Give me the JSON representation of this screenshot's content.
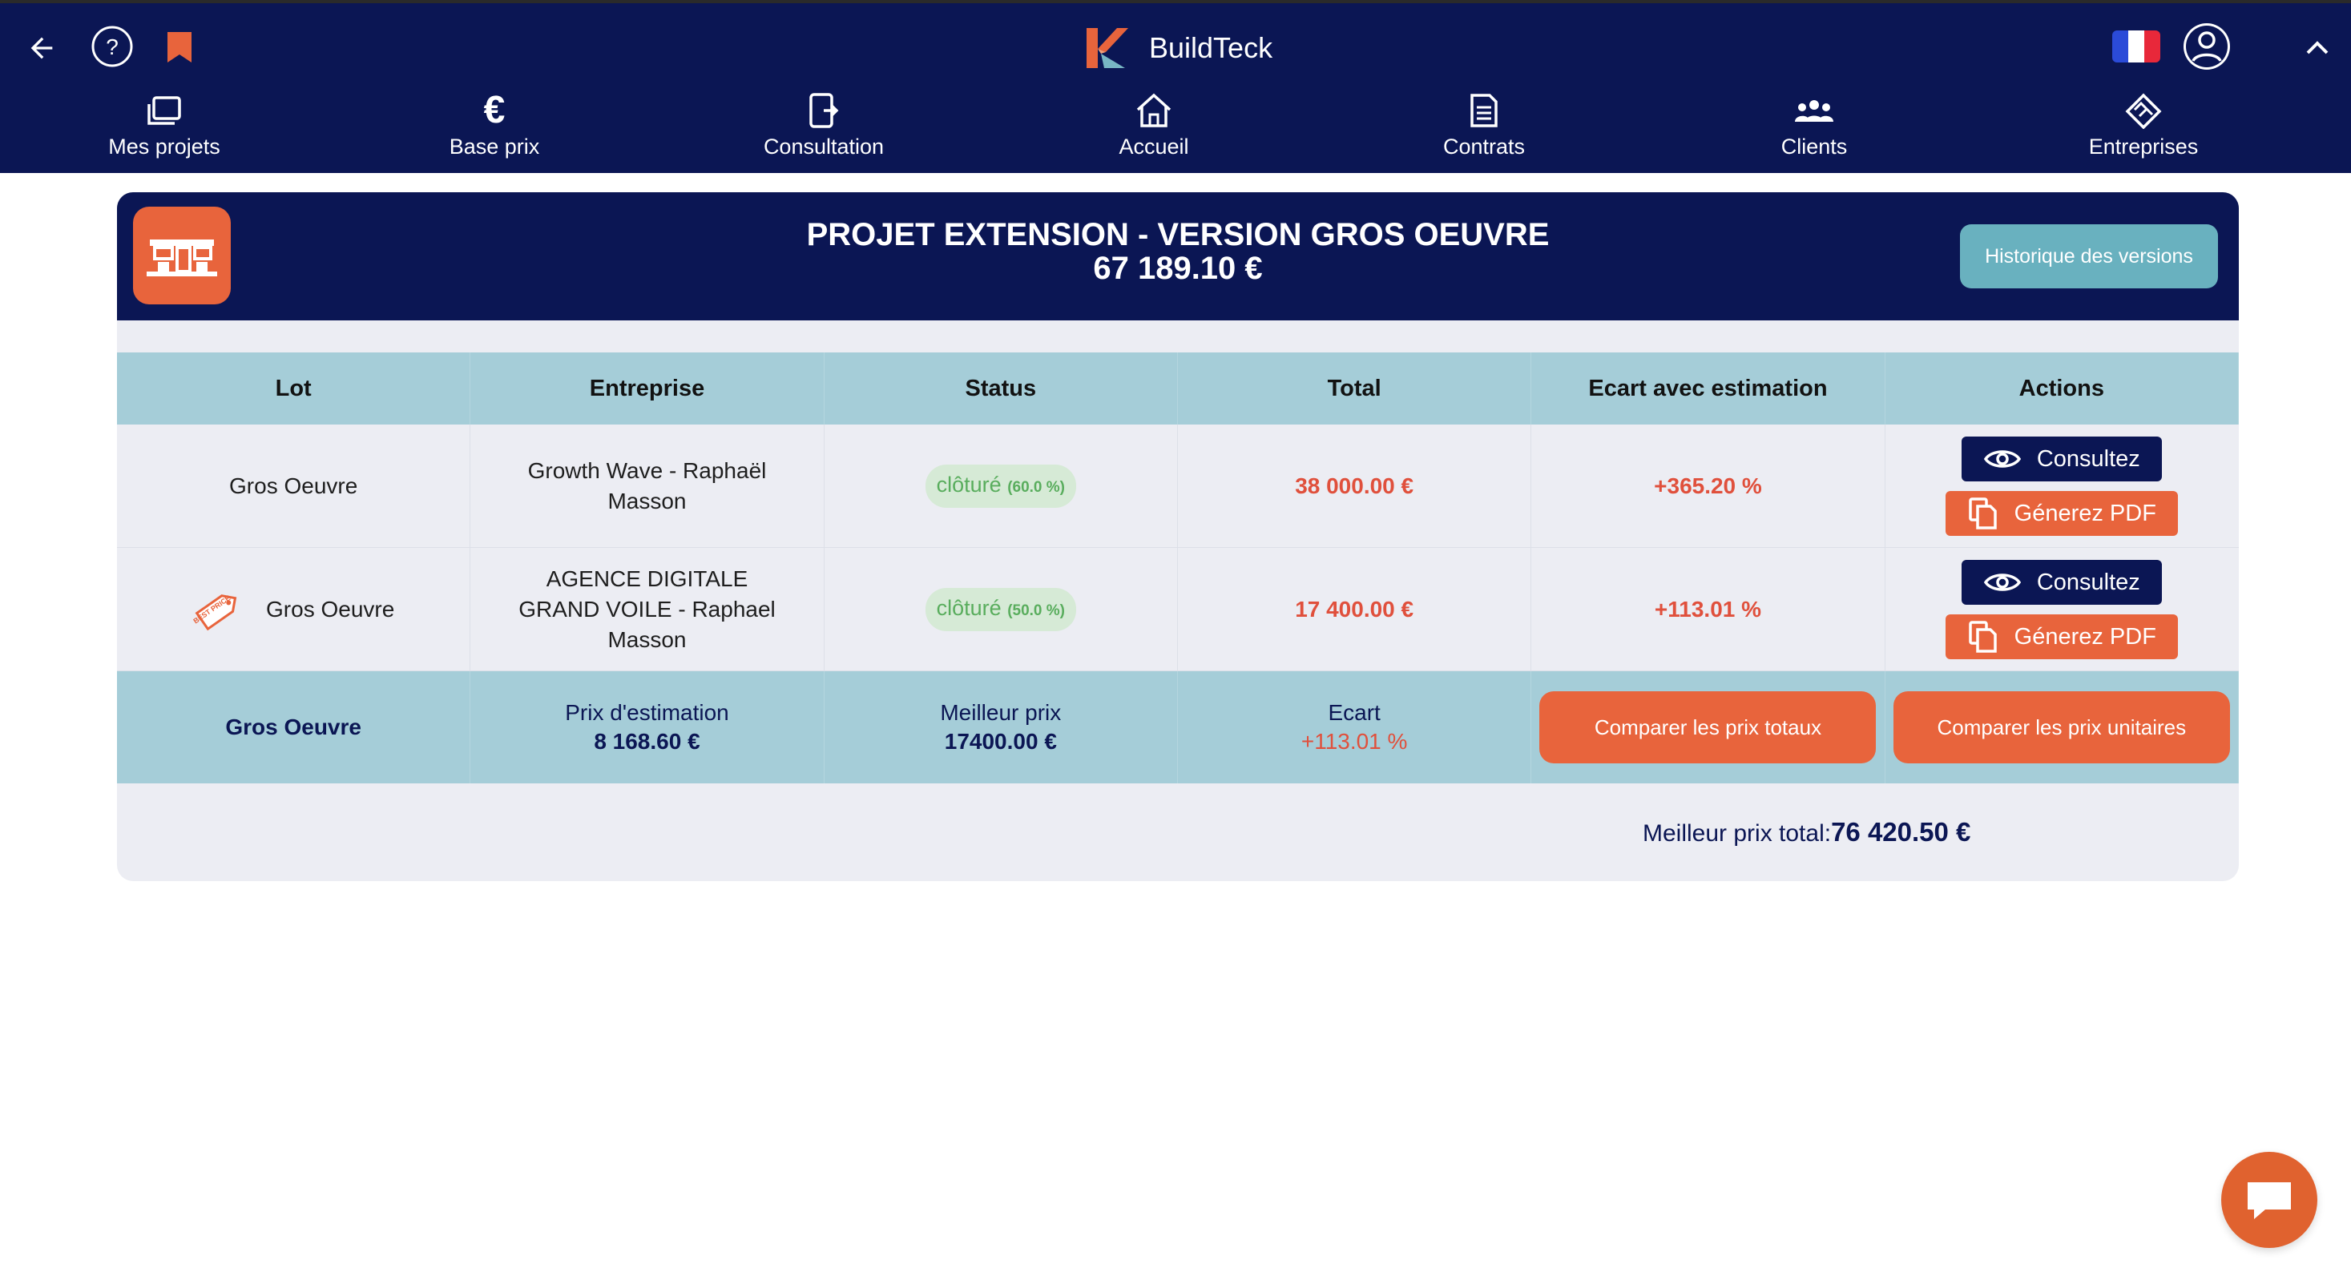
{
  "app": {
    "name": "BuildTeck"
  },
  "nav": [
    {
      "label": "Mes projets",
      "icon": "folders-icon"
    },
    {
      "label": "Base prix",
      "icon": "euro-icon"
    },
    {
      "label": "Consultation",
      "icon": "consultation-icon"
    },
    {
      "label": "Accueil",
      "icon": "home-icon"
    },
    {
      "label": "Contrats",
      "icon": "document-icon"
    },
    {
      "label": "Clients",
      "icon": "clients-icon"
    },
    {
      "label": "Entreprises",
      "icon": "handshake-icon"
    }
  ],
  "project": {
    "title": "PROJET EXTENSION - VERSION GROS OEUVRE",
    "total": "67 189.10 €",
    "history_button": "Historique des versions"
  },
  "table": {
    "headers": [
      "Lot",
      "Entreprise",
      "Status",
      "Total",
      "Ecart avec estimation",
      "Actions"
    ],
    "rows": [
      {
        "lot": "Gros Oeuvre",
        "best_price_tag": false,
        "entreprise": "Growth Wave - Raphaël Masson",
        "status": "clôturé",
        "status_pct": "(60.0 %)",
        "total": "38 000.00 €",
        "ecart": "+365.20 %"
      },
      {
        "lot": "Gros Oeuvre",
        "best_price_tag": true,
        "best_price_text": "BEST PRICE",
        "entreprise": "AGENCE DIGITALE GRAND VOILE - Raphael Masson",
        "status": "clôturé",
        "status_pct": "(50.0 %)",
        "total": "17 400.00 €",
        "ecart": "+113.01 %"
      }
    ],
    "action_consult": "Consultez",
    "action_pdf": "Génerez PDF",
    "summary": {
      "lot": "Gros Oeuvre",
      "estimation_label": "Prix d'estimation",
      "estimation_value": "8 168.60 €",
      "best_label": "Meilleur prix",
      "best_value": "17400.00 €",
      "ecart_label": "Ecart",
      "ecart_value": "+113.01 %",
      "compare_totals": "Comparer les prix totaux",
      "compare_units": "Comparer les prix unitaires"
    }
  },
  "best_total": {
    "label": "Meilleur prix total:",
    "value": "76 420.50 €"
  },
  "colors": {
    "navy": "#0b1654",
    "orange": "#e8643c",
    "teal": "#a5cdd8",
    "green": "#59ad5d",
    "red": "#e0503c"
  }
}
